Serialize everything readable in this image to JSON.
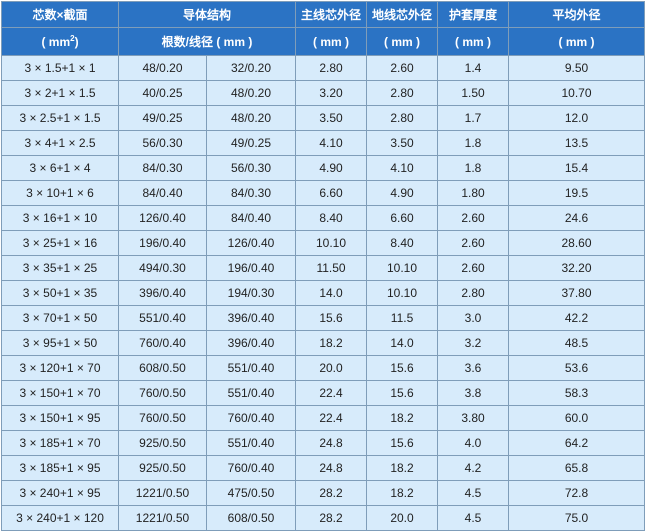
{
  "header": {
    "col1_line1": "芯数×截面",
    "col1_line2_unit": "( mm",
    "col1_line2_sup": "2",
    "col1_line2_close": ")",
    "col2_line1": "导体结构",
    "col2_line2": "根数/线径 ( mm )",
    "col3_line1": "主线芯外径",
    "col3_line2": "( mm )",
    "col4_line1": "地线芯外径",
    "col4_line2": "( mm )",
    "col5_line1": "护套厚度",
    "col5_line2": "( mm )",
    "col6_line1": "平均外径",
    "col6_line2": "( mm )"
  },
  "rows": [
    [
      "3 × 1.5+1 × 1",
      "48/0.20",
      "32/0.20",
      "2.80",
      "2.60",
      "1.4",
      "9.50"
    ],
    [
      "3 × 2+1 × 1.5",
      "40/0.25",
      "48/0.20",
      "3.20",
      "2.80",
      "1.50",
      "10.70"
    ],
    [
      "3 × 2.5+1 × 1.5",
      "49/0.25",
      "48/0.20",
      "3.50",
      "2.80",
      "1.7",
      "12.0"
    ],
    [
      "3 × 4+1 × 2.5",
      "56/0.30",
      "49/0.25",
      "4.10",
      "3.50",
      "1.8",
      "13.5"
    ],
    [
      "3 × 6+1 × 4",
      "84/0.30",
      "56/0.30",
      "4.90",
      "4.10",
      "1.8",
      "15.4"
    ],
    [
      "3 × 10+1 × 6",
      "84/0.40",
      "84/0.30",
      "6.60",
      "4.90",
      "1.80",
      "19.5"
    ],
    [
      "3 × 16+1 × 10",
      "126/0.40",
      "84/0.40",
      "8.40",
      "6.60",
      "2.60",
      "24.6"
    ],
    [
      "3 × 25+1 × 16",
      "196/0.40",
      "126/0.40",
      "10.10",
      "8.40",
      "2.60",
      "28.60"
    ],
    [
      "3 × 35+1 × 25",
      "494/0.30",
      "196/0.40",
      "11.50",
      "10.10",
      "2.60",
      "32.20"
    ],
    [
      "3 × 50+1 × 35",
      "396/0.40",
      "194/0.30",
      "14.0",
      "10.10",
      "2.80",
      "37.80"
    ],
    [
      "3 × 70+1 × 50",
      "551/0.40",
      "396/0.40",
      "15.6",
      "11.5",
      "3.0",
      "42.2"
    ],
    [
      "3 × 95+1 × 50",
      "760/0.40",
      "396/0.40",
      "18.2",
      "14.0",
      "3.2",
      "48.5"
    ],
    [
      "3 × 120+1 × 70",
      "608/0.50",
      "551/0.40",
      "20.0",
      "15.6",
      "3.6",
      "53.6"
    ],
    [
      "3 × 150+1 × 70",
      "760/0.50",
      "551/0.40",
      "22.4",
      "15.6",
      "3.8",
      "58.3"
    ],
    [
      "3 × 150+1 × 95",
      "760/0.50",
      "760/0.40",
      "22.4",
      "18.2",
      "3.80",
      "60.0"
    ],
    [
      "3 × 185+1 × 70",
      "925/0.50",
      "551/0.40",
      "24.8",
      "15.6",
      "4.0",
      "64.2"
    ],
    [
      "3 × 185+1 × 95",
      "925/0.50",
      "760/0.40",
      "24.8",
      "18.2",
      "4.2",
      "65.8"
    ],
    [
      "3 × 240+1 × 95",
      "1221/0.50",
      "475/0.50",
      "28.2",
      "18.2",
      "4.5",
      "72.8"
    ],
    [
      "3 × 240+1 × 120",
      "1221/0.50",
      "608/0.50",
      "28.2",
      "20.0",
      "4.5",
      "75.0"
    ]
  ]
}
